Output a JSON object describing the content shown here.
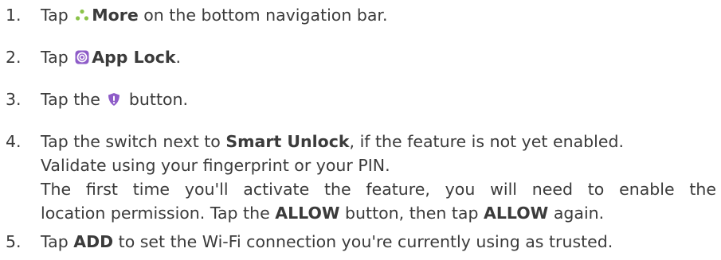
{
  "steps": [
    {
      "number": "1.",
      "pre": "Tap ",
      "icon": "more-dots-icon",
      "bold": "More",
      "post": " on the bottom navigation bar."
    },
    {
      "number": "2.",
      "pre": "Tap ",
      "icon": "app-lock-icon",
      "bold": "App Lock",
      "post": "."
    },
    {
      "number": "3.",
      "pre": "Tap the ",
      "icon": "shield-alert-icon",
      "post": " button."
    },
    {
      "number": "4.",
      "line1_pre": "Tap the switch next to ",
      "line1_bold": "Smart Unlock",
      "line1_post": ", if the feature is not yet enabled.",
      "line2": "Validate using your fingerprint or your PIN.",
      "line3": "The first time you'll activate the feature, you will need to enable the",
      "line4_pre": "location permission. Tap the ",
      "line4_bold1": "ALLOW",
      "line4_mid": " button, then tap ",
      "line4_bold2": "ALLOW",
      "line4_post": " again."
    },
    {
      "number": "5.",
      "pre": "Tap ",
      "bold": "ADD",
      "post": " to set the Wi-Fi connection you're currently using as trusted."
    }
  ],
  "colors": {
    "text": "#3b3b3b",
    "icon_green": "#8bc34a",
    "icon_green_dark": "#5a9e2a",
    "icon_purple": "#8e5cc8"
  }
}
